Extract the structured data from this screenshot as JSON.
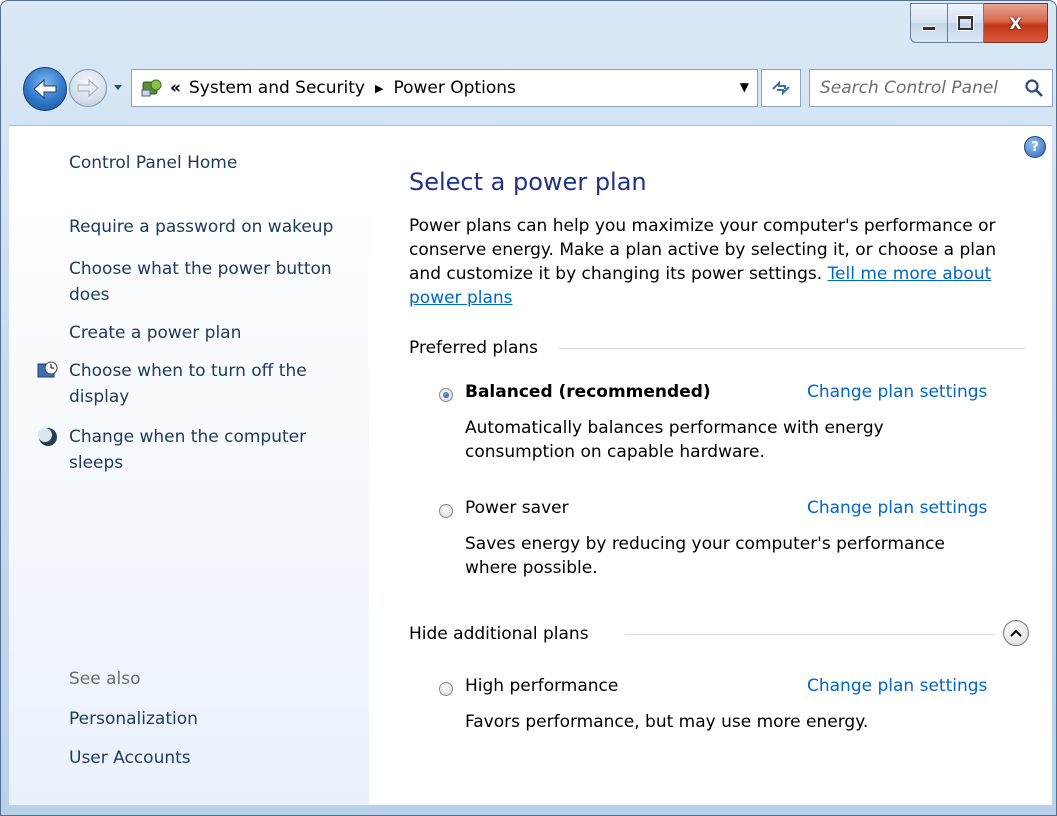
{
  "window": {
    "controls": {
      "minimize": "minimize",
      "maximize": "maximize",
      "close": "X"
    }
  },
  "navbar": {
    "breadcrumb_overflow": "«",
    "breadcrumbs": [
      "System and Security",
      "Power Options"
    ],
    "search_placeholder": "Search Control Panel"
  },
  "sidebar": {
    "home": "Control Panel Home",
    "links": [
      "Require a password on wakeup",
      "Choose what the power button does",
      "Create a power plan",
      "Choose when to turn off the display",
      "Change when the computer sleeps"
    ],
    "see_also_label": "See also",
    "see_also_links": [
      "Personalization",
      "User Accounts"
    ]
  },
  "main": {
    "title": "Select a power plan",
    "description": "Power plans can help you maximize your computer's performance or conserve energy. Make a plan active by selecting it, or choose a plan and customize it by changing its power settings.",
    "description_link": "Tell me more about power plans",
    "preferred_heading": "Preferred plans",
    "additional_heading": "Hide additional plans",
    "plans": [
      {
        "name": "Balanced (recommended)",
        "selected": true,
        "link": "Change plan settings",
        "description": "Automatically balances performance with energy consumption on capable hardware."
      },
      {
        "name": "Power saver",
        "selected": false,
        "link": "Change plan settings",
        "description": "Saves energy by reducing your computer's performance where possible."
      },
      {
        "name": "High performance",
        "selected": false,
        "link": "Change plan settings",
        "description": "Favors performance, but may use more energy."
      }
    ]
  },
  "colors": {
    "link": "#0066cc",
    "title": "#1e3287",
    "sidebar_text": "#1e395b"
  }
}
